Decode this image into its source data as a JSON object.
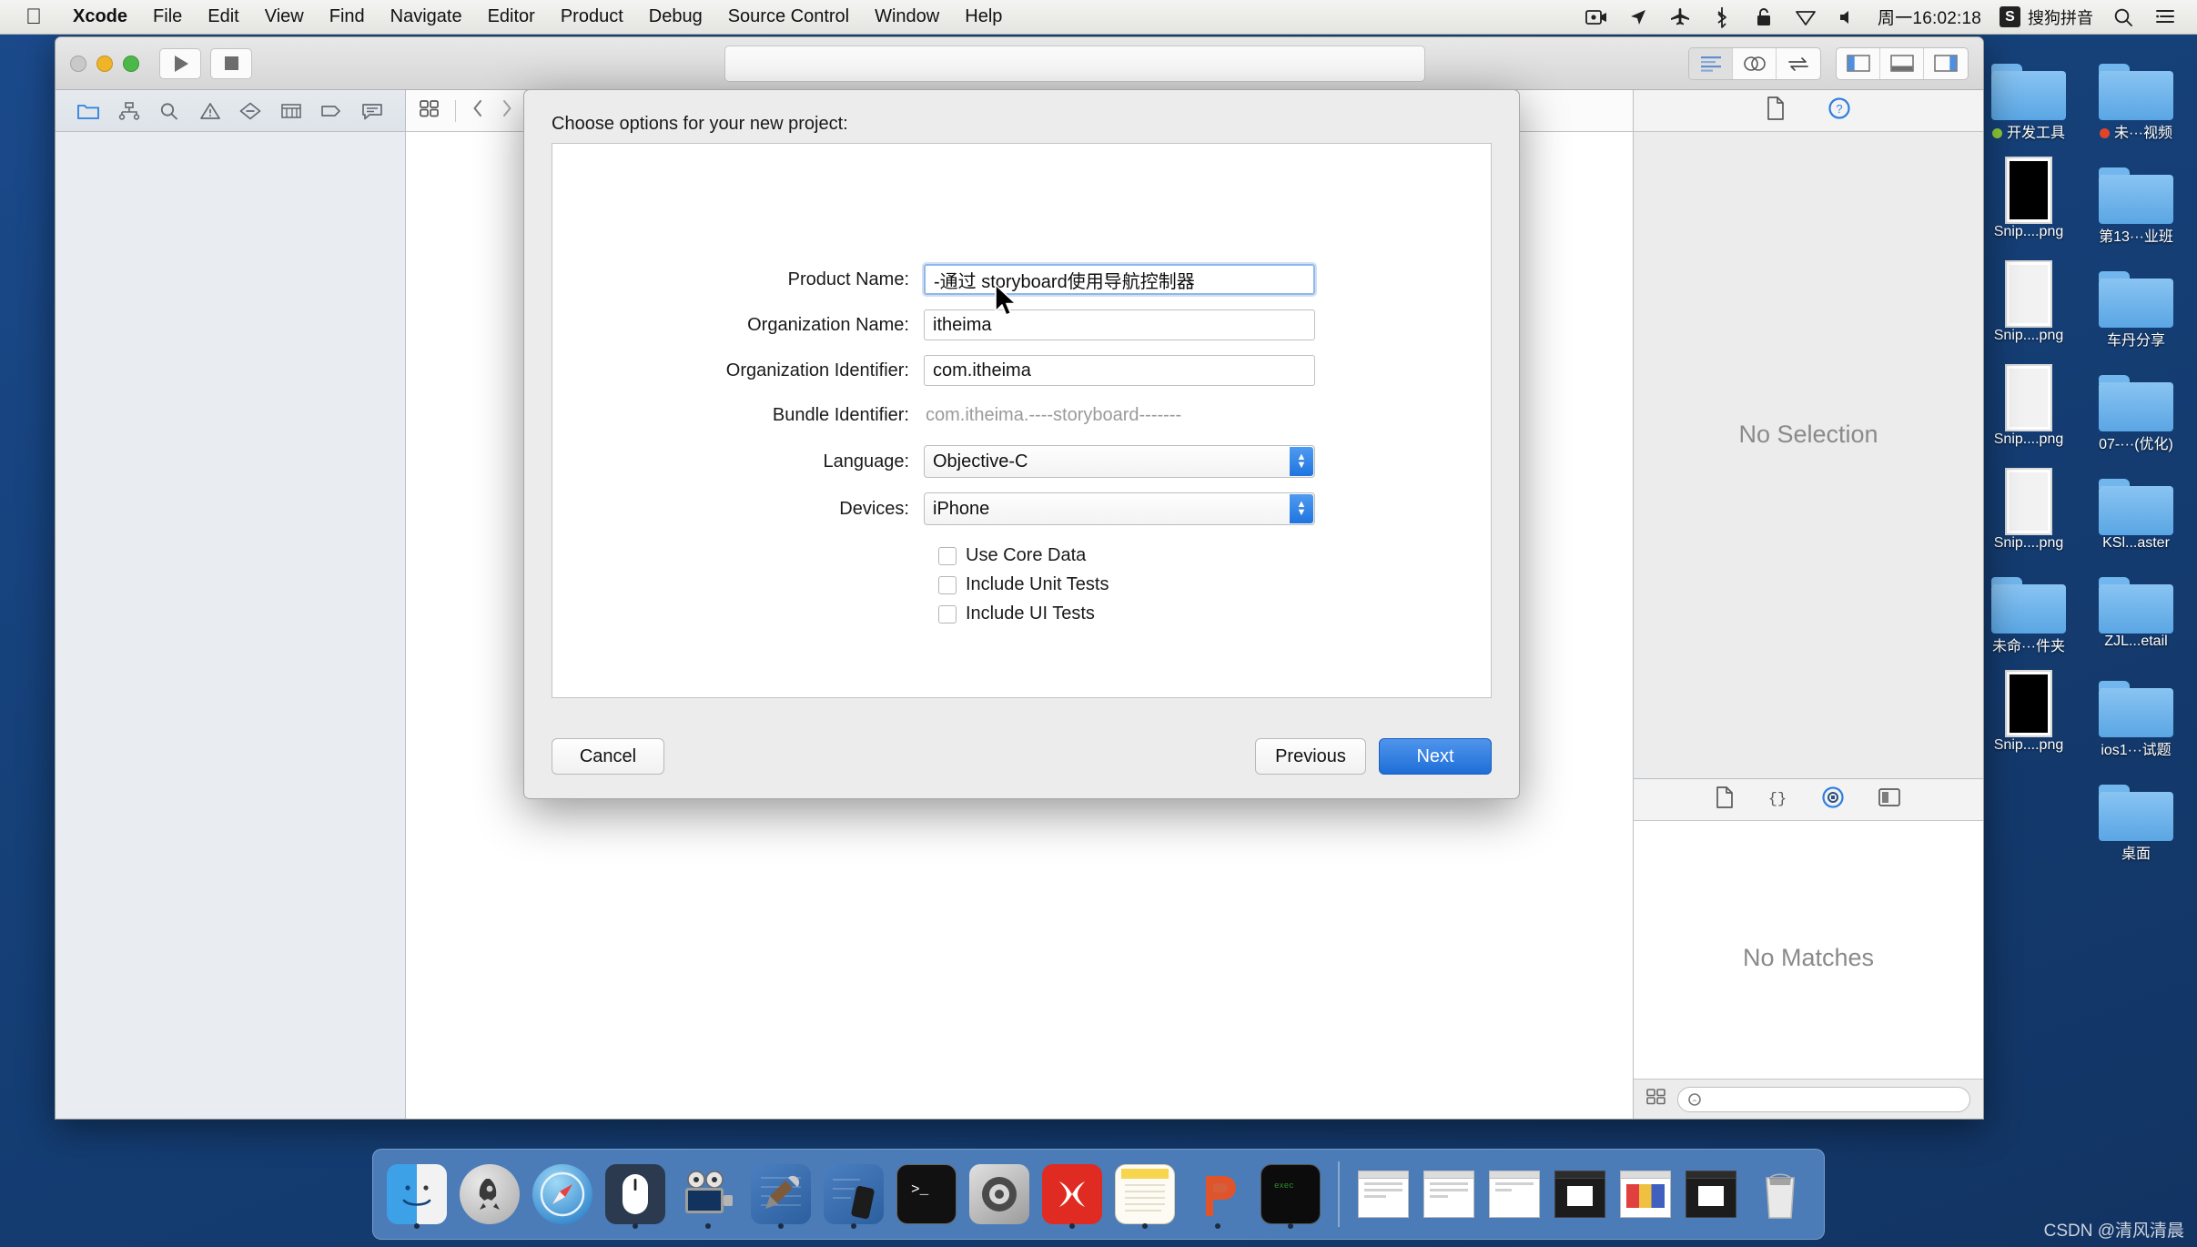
{
  "menubar": {
    "apple_icon": "apple-logo-icon",
    "items": [
      {
        "label": "Xcode",
        "bold": true
      },
      {
        "label": "File",
        "bold": false
      },
      {
        "label": "Edit",
        "bold": false
      },
      {
        "label": "View",
        "bold": false
      },
      {
        "label": "Find",
        "bold": false
      },
      {
        "label": "Navigate",
        "bold": false
      },
      {
        "label": "Editor",
        "bold": false
      },
      {
        "label": "Product",
        "bold": false
      },
      {
        "label": "Debug",
        "bold": false
      },
      {
        "label": "Source Control",
        "bold": false
      },
      {
        "label": "Window",
        "bold": false
      },
      {
        "label": "Help",
        "bold": false
      }
    ],
    "status_icons": [
      "screen-recording-icon",
      "location-arrow-icon",
      "airplane-icon",
      "bluetooth-icon",
      "lock-icon",
      "dropbox-icon",
      "volume-icon"
    ],
    "clock": "周一16:02:18",
    "ime_badge": "S",
    "ime_label": "搜狗拼音",
    "search_icon": "search-icon",
    "control_center_icon": "notification-center-icon"
  },
  "xcode": {
    "toolbar": {
      "run_icon": "play-icon",
      "stop_icon": "stop-icon",
      "status_bar_text": "",
      "editor_segment": [
        "standard-editor-icon",
        "assistant-editor-icon",
        "version-editor-icon"
      ],
      "view_segment": [
        "navigator-toggle-icon",
        "debug-area-toggle-icon",
        "utilities-toggle-icon"
      ]
    },
    "navigator_tabs": [
      "project-navigator-icon",
      "source-control-navigator-icon",
      "find-navigator-icon",
      "issue-navigator-icon",
      "test-navigator-icon",
      "debug-navigator-icon",
      "breakpoint-navigator-icon",
      "report-navigator-icon"
    ],
    "editor_strip": {
      "related_items_icon": "related-items-icon",
      "back_icon": "chevron-left-icon",
      "forward_icon": "chevron-right-icon"
    },
    "inspector": {
      "top_tabs": [
        "file-inspector-icon",
        "quick-help-icon"
      ],
      "top_empty_text": "No Selection",
      "bottom_tabs": [
        "file-template-library-icon",
        "code-snippet-library-icon",
        "object-library-icon",
        "media-library-icon"
      ],
      "bottom_empty_text": "No Matches",
      "library_filter_icon": "grid-icon",
      "library_search_placeholder": ""
    }
  },
  "sheet": {
    "title": "Choose options for your new project:",
    "fields": [
      {
        "label": "Product Name:",
        "value": "-通过 storyboard使用导航控制器",
        "type": "text",
        "focused": true
      },
      {
        "label": "Organization Name:",
        "value": "itheima",
        "type": "text",
        "focused": false
      },
      {
        "label": "Organization Identifier:",
        "value": "com.itheima",
        "type": "text",
        "focused": false
      },
      {
        "label": "Bundle Identifier:",
        "value": "com.itheima.----storyboard-------",
        "type": "static",
        "focused": false
      },
      {
        "label": "Language:",
        "value": "Objective-C",
        "type": "select",
        "focused": false
      },
      {
        "label": "Devices:",
        "value": "iPhone",
        "type": "select",
        "focused": false
      }
    ],
    "checkboxes": [
      {
        "label": "Use Core Data",
        "checked": false
      },
      {
        "label": "Include Unit Tests",
        "checked": false
      },
      {
        "label": "Include UI Tests",
        "checked": false
      }
    ],
    "buttons": {
      "cancel": "Cancel",
      "previous": "Previous",
      "next": "Next"
    },
    "accent_color": "#2a7ae2"
  },
  "desktop": {
    "icons": [
      {
        "label": "开发工具",
        "type": "folder",
        "tag": "#8fc93a"
      },
      {
        "label": "未···视频",
        "type": "folder",
        "tag": "#e0452c"
      },
      {
        "label": "Snip....png",
        "type": "screenshot-dark"
      },
      {
        "label": "第13···业班",
        "type": "folder"
      },
      {
        "label": "Snip....png",
        "type": "screenshot"
      },
      {
        "label": "车丹分享",
        "type": "folder"
      },
      {
        "label": "Snip....png",
        "type": "screenshot"
      },
      {
        "label": "07-···(优化)",
        "type": "folder"
      },
      {
        "label": "Snip....png",
        "type": "screenshot"
      },
      {
        "label": "KSl...aster",
        "type": "folder"
      },
      {
        "label": "未命···件夹",
        "type": "folder"
      },
      {
        "label": "ZJL...etail",
        "type": "folder"
      },
      {
        "label": "Snip....png",
        "type": "screenshot-dark"
      },
      {
        "label": "ios1···试题",
        "type": "folder"
      },
      {
        "label": "",
        "type": "none"
      },
      {
        "label": "桌面",
        "type": "folder"
      }
    ]
  },
  "dock": {
    "apps": [
      {
        "name": "finder-icon",
        "running": true
      },
      {
        "name": "launchpad-icon",
        "running": false
      },
      {
        "name": "safari-icon",
        "running": false
      },
      {
        "name": "mouse-app-icon",
        "running": true
      },
      {
        "name": "quicktime-icon",
        "running": true
      },
      {
        "name": "xcode-icon",
        "running": true
      },
      {
        "name": "simulator-icon",
        "running": true
      },
      {
        "name": "terminal-icon",
        "running": false
      },
      {
        "name": "system-preferences-icon",
        "running": false
      },
      {
        "name": "xmind-icon",
        "running": true
      },
      {
        "name": "notes-icon",
        "running": true
      },
      {
        "name": "postman-icon",
        "running": true
      },
      {
        "name": "iterm-icon",
        "running": true
      }
    ],
    "minimized": [
      "minimized-window-finder",
      "minimized-window-postman",
      "minimized-window-xmind",
      "minimized-window-keynote",
      "minimized-window-postman-2",
      "minimized-window-keynote-2"
    ],
    "trash_icon": "trash-icon"
  },
  "watermark": "CSDN @清风清晨"
}
